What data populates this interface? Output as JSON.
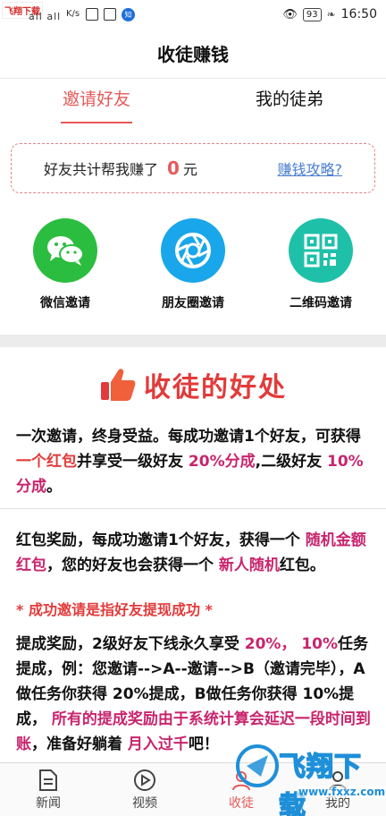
{
  "status_bar": {
    "brand": "飞翔下载",
    "signal": "all all",
    "speed": "K/s",
    "battery": "93",
    "time": "16:50",
    "small_icon_text": "知"
  },
  "header": {
    "title": "收徒赚钱"
  },
  "tabs": [
    {
      "label": "邀请好友",
      "active": true
    },
    {
      "label": "我的徒弟",
      "active": false
    }
  ],
  "earnings": {
    "label": "好友共计帮我赚了",
    "amount": "0",
    "unit": "元",
    "guide_link": "赚钱攻略?"
  },
  "share": [
    {
      "label": "微信邀请",
      "icon": "wechat-icon",
      "color": "#2bbd3f"
    },
    {
      "label": "朋友圈邀请",
      "icon": "moments-icon",
      "color": "#1aa6ea"
    },
    {
      "label": "二维码邀请",
      "icon": "qrcode-icon",
      "color": "#1fc0a8"
    }
  ],
  "benefits": {
    "title": "收徒的好处",
    "p1": {
      "a": "一次邀请，终身受益。每成功邀请1个好友，可获得",
      "b": " 一个红包",
      "c": "并享受一级好友",
      "d": " 20%分成",
      "e": ",二级好友",
      "f": " 10%分成",
      "g": "。"
    },
    "p2": {
      "a": "红包奖励，每成功邀请1个好友，获得一个",
      "b": " 随机金额红包",
      "c": "，您的好友也会获得一个",
      "d": " 新人随机",
      "e": "红包。"
    },
    "note": "* 成功邀请是指好友提现成功 *",
    "p3": {
      "a": "提成奖励，2级好友下线永久享受",
      "b": " 20%，  10%",
      "c": "任务提成，例：您邀请-->A--邀请-->B（邀请完毕），A做任务你获得 20%提成，B做任务你获得 10%提成，",
      "d": "  所有的提成奖励由于系统计算会延迟一段时间到账",
      "e": "，准备好躺着",
      "f": "  月入过千",
      "g": "吧！"
    }
  },
  "bottom_nav": [
    {
      "label": "新闻",
      "icon": "news-icon",
      "active": false
    },
    {
      "label": "视频",
      "icon": "video-icon",
      "active": false
    },
    {
      "label": "收徒",
      "icon": "apprentice-icon",
      "active": true
    },
    {
      "label": "我的",
      "icon": "profile-icon",
      "active": false
    }
  ],
  "watermark": {
    "text": "飞翔下载",
    "url": "www.fxxz.com"
  },
  "colors": {
    "accent": "#e55a5a",
    "highlight_red": "#e23b3b",
    "highlight_pink": "#c8256d",
    "link_blue": "#4a7ed0"
  }
}
